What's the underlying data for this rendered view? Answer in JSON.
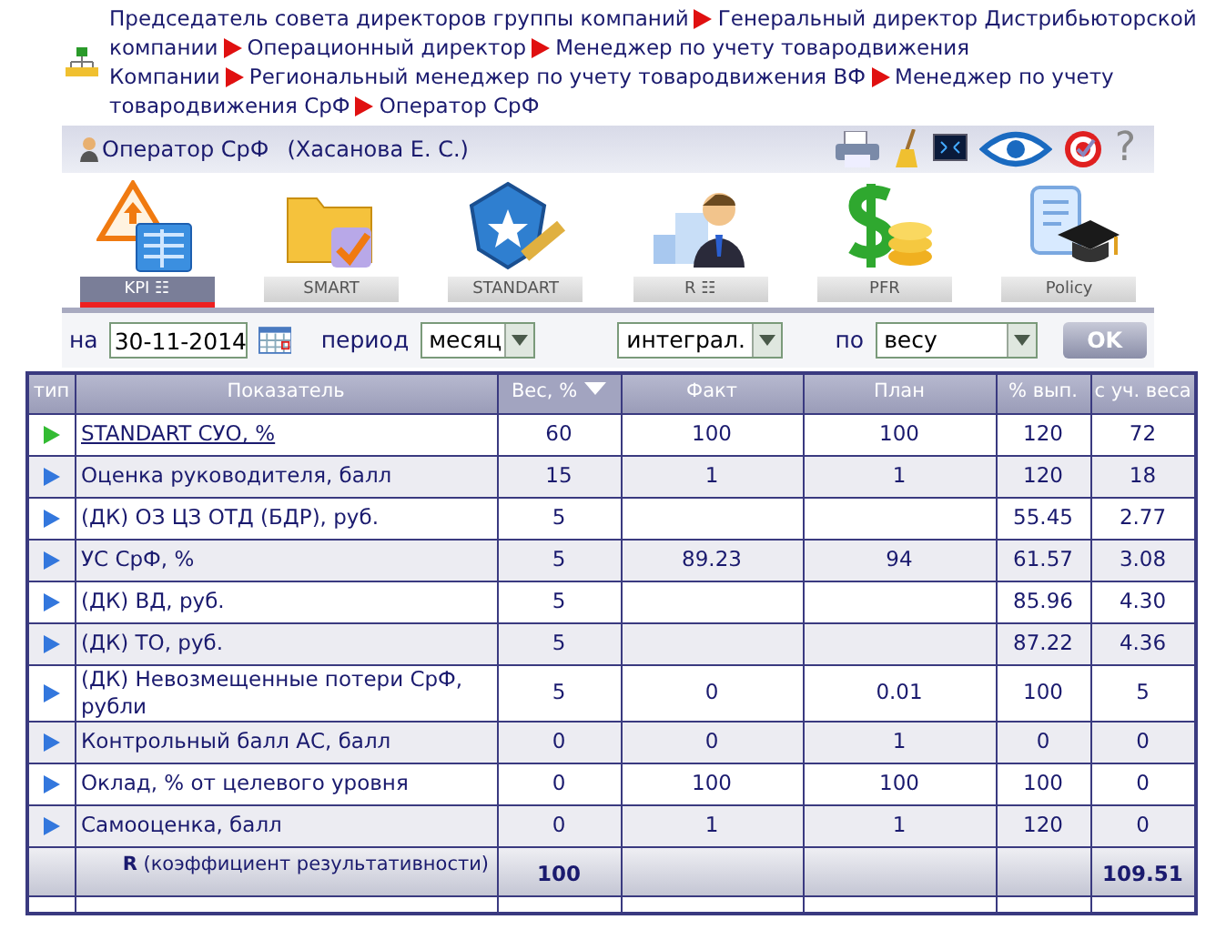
{
  "breadcrumb_lines": [
    [
      "Председатель совета директоров группы компаний",
      "Генеральный директор Дистрибьюторской"
    ],
    [
      "компании",
      "Операционный директор",
      "Менеджер по учету товародвижения"
    ],
    [
      "Компании",
      "Региональный менеджер по учету товародвижения ВФ",
      "Менеджер по учету"
    ],
    [
      "товародвижения СрФ",
      "Оператор СрФ"
    ]
  ],
  "user": {
    "role": "Оператор СрФ",
    "name": "(Хасанова Е. С.)"
  },
  "toolbar_help": "?",
  "modules": [
    {
      "kind": "kpi",
      "label": "KPI ☷",
      "selected": true
    },
    {
      "kind": "smart",
      "label": "SMART",
      "selected": false
    },
    {
      "kind": "standart",
      "label": "STANDART",
      "selected": false
    },
    {
      "kind": "r",
      "label": "R ☷",
      "selected": false
    },
    {
      "kind": "pfr",
      "label": "PFR",
      "selected": false
    },
    {
      "kind": "policy",
      "label": "Policy",
      "selected": false
    }
  ],
  "filters": {
    "date_label": "на",
    "date": "30-11-2014",
    "period_label": "период",
    "period": "месяц",
    "mode": "интеграл.",
    "by_label": "по",
    "by": "весу",
    "ok": "OK"
  },
  "table": {
    "columns": [
      {
        "label": "тип",
        "sorted": false
      },
      {
        "label": "Показатель",
        "sorted": false
      },
      {
        "label": "Вес, %",
        "sorted": true
      },
      {
        "label": "Факт",
        "sorted": false
      },
      {
        "label": "План",
        "sorted": false
      },
      {
        "label": "% вып.",
        "sorted": false
      },
      {
        "label": "с уч. веса",
        "sorted": false
      }
    ],
    "rows": [
      {
        "color": "#33bb33",
        "link": true,
        "name": "STANDART СУО, %",
        "weight": "60",
        "fact": "100",
        "plan": "100",
        "pct": "120",
        "weighted": "72"
      },
      {
        "color": "#3377dd",
        "link": false,
        "name": "Оценка руководителя, балл",
        "weight": "15",
        "fact": "1",
        "plan": "1",
        "pct": "120",
        "weighted": "18"
      },
      {
        "color": "#3377dd",
        "link": false,
        "name": "(ДК) ОЗ ЦЗ ОТД (БДР), руб.",
        "weight": "5",
        "pct": "55.45",
        "weighted": "2.77"
      },
      {
        "color": "#3377dd",
        "link": false,
        "name": "УС СрФ, %",
        "weight": "5",
        "fact": "89.23",
        "plan": "94",
        "pct": "61.57",
        "weighted": "3.08"
      },
      {
        "color": "#3377dd",
        "link": false,
        "name": "(ДК) ВД, руб.",
        "weight": "5",
        "pct": "85.96",
        "weighted": "4.30"
      },
      {
        "color": "#3377dd",
        "link": false,
        "name": "(ДК) ТО, руб.",
        "weight": "5",
        "pct": "87.22",
        "weighted": "4.36"
      },
      {
        "color": "#3377dd",
        "link": false,
        "name": "(ДК) Невозмещенные потери СрФ, рубли",
        "weight": "5",
        "fact": "0",
        "plan": "0.01",
        "pct": "100",
        "weighted": "5"
      },
      {
        "color": "#3377dd",
        "link": false,
        "name": "Контрольный балл АС, балл",
        "weight": "0",
        "fact": "0",
        "plan": "1",
        "pct": "0",
        "weighted": "0"
      },
      {
        "color": "#3377dd",
        "link": false,
        "name": "Оклад, % от целевого уровня",
        "weight": "0",
        "fact": "100",
        "plan": "100",
        "pct": "100",
        "weighted": "0"
      },
      {
        "color": "#3377dd",
        "link": false,
        "name": "Самооценка, балл",
        "weight": "0",
        "fact": "1",
        "plan": "1",
        "pct": "120",
        "weighted": "0"
      }
    ],
    "total": {
      "label": "**R** (коэффициент результативности)",
      "weight": "100",
      "weighted": "109.51"
    }
  }
}
